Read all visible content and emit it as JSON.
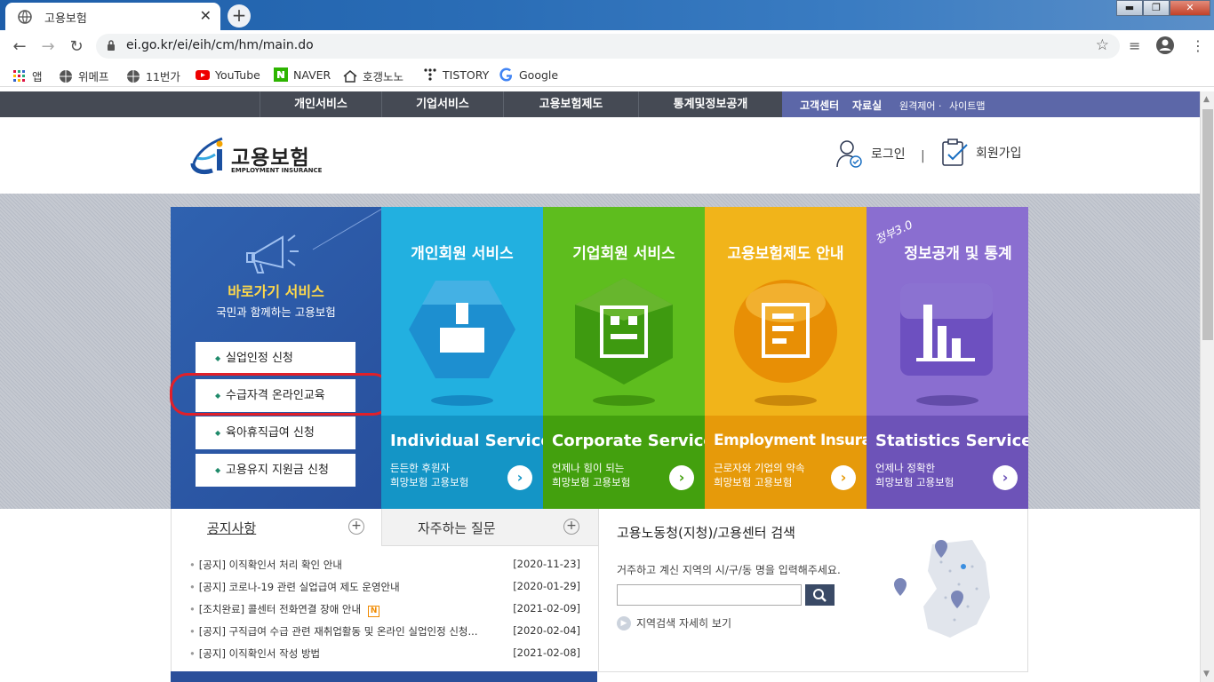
{
  "browser": {
    "tab_title": "고용보험",
    "new_tab": "+",
    "url": "ei.go.kr/ei/eih/cm/hm/main.do",
    "window_buttons": [
      "▬",
      "❐",
      "✕"
    ],
    "bookmarks": [
      "앱",
      "위메프",
      "11번가",
      "YouTube",
      "NAVER",
      "호갱노노",
      "TISTORY",
      "Google"
    ]
  },
  "gnb": {
    "menus": [
      "개인서비스",
      "기업서비스",
      "고용보험제도",
      "통계및정보공개"
    ],
    "right": [
      "고객센터",
      "자료실",
      "원격제어 · ",
      "사이트맵"
    ]
  },
  "header": {
    "logo_text": "고용보험",
    "logo_sub": "EMPLOYMENT INSURANCE",
    "login": "로그인",
    "sep": "|",
    "join": "회원가입"
  },
  "quick": {
    "title": "바로가기 서비스",
    "subtitle": "국민과 함께하는 고용보험",
    "items": [
      "실업인정 신청",
      "수급자격 온라인교육",
      "육아휴직급여 신청",
      "고용유지 지원금 신청"
    ]
  },
  "services": [
    {
      "title": "개인회원 서비스",
      "en": "Individual Service",
      "desc1": "든든한 후원자",
      "desc2": "희망보험 고용보험",
      "arrow": "›",
      "color": "#22b0e0"
    },
    {
      "title": "기업회원 서비스",
      "en": "Corporate Service",
      "desc1": "언제나 힘이 되는",
      "desc2": "희망보험 고용보험",
      "arrow": "›",
      "color": "#5ebd1e"
    },
    {
      "title": "고용보험제도 안내",
      "en": "Employment Insurance",
      "desc1": "근로자와 기업의 약속",
      "desc2": "희망보험 고용보험",
      "arrow": "›",
      "color": "#f1b41a"
    },
    {
      "title": "정보공개 및 통계",
      "badge": "정부3.0",
      "en": "Statistics Service",
      "desc1": "언제나 정확한",
      "desc2": "희망보험 고용보험",
      "arrow": "›",
      "color": "#8a6ed0"
    }
  ],
  "board": {
    "tab_notice": "공지사항",
    "tab_faq": "자주하는 질문",
    "plus": "+",
    "notices": [
      {
        "text": "[공지] 이직확인서 처리 확인 안내",
        "date": "[2020-11-23]"
      },
      {
        "text": "[공지] 코로나-19 관련 실업급여 제도 운영안내",
        "date": "[2020-01-29]"
      },
      {
        "text": "[조치완료] 콜센터 전화연결 장애 안내",
        "date": "[2021-02-09]",
        "badge": "N"
      },
      {
        "text": "[공지] 구직급여 수급 관련 재취업활동 및 온라인 실업인정 신청...",
        "date": "[2020-02-04]"
      },
      {
        "text": "[공지] 이직확인서 작성 방법",
        "date": "[2021-02-08]"
      }
    ]
  },
  "center_search": {
    "title": "고용노동청(지청)/고용센터 검색",
    "desc": "거주하고 계신 지역의 시/구/동 명을 입력해주세요.",
    "input_value": "",
    "more": "지역검색 자세히 보기"
  }
}
